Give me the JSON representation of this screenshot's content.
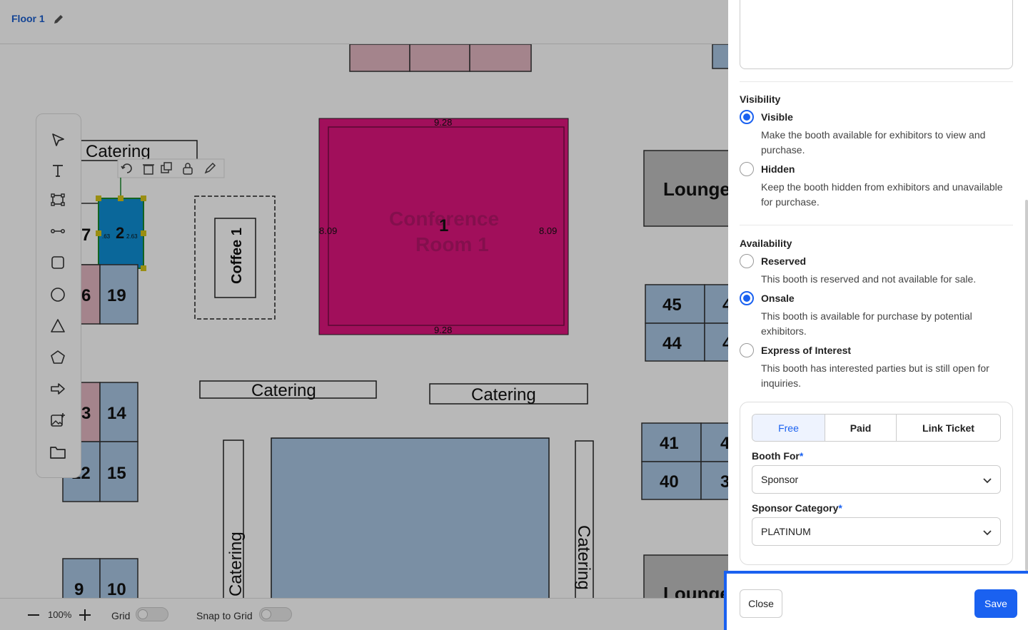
{
  "header": {
    "floor_name": "Floor 1"
  },
  "floor_plan": {
    "catering_labels": [
      "Catering",
      "Catering",
      "Catering",
      "Catering",
      "Catering"
    ],
    "lounge_labels": [
      "Lounge",
      "Lounge"
    ],
    "coffee_label": "Coffee 1",
    "conference": {
      "title_line1": "Conference",
      "title_line2": "Room 1",
      "number": "1",
      "width_top": "9.28",
      "width_bottom": "9.28",
      "height_left": "8.09",
      "height_right": "8.09"
    },
    "selected_booth": {
      "number": "2",
      "dim_left": ".63",
      "dim_right": "2.63"
    },
    "booths": {
      "b7": "7",
      "b6": "6",
      "b19": "19",
      "b3": "3",
      "b14": "14",
      "b12": "12",
      "b15": "15",
      "b9": "9",
      "b10": "10",
      "b45": "45",
      "b44": "44",
      "b41": "41",
      "b40": "40",
      "b45b": "4",
      "b44b": "4",
      "b41b": "4",
      "b40b": "3"
    }
  },
  "bottom_bar": {
    "zoom_level": "100%",
    "grid_label": "Grid",
    "snap_label": "Snap to Grid"
  },
  "panel": {
    "visibility": {
      "title": "Visibility",
      "visible_label": "Visible",
      "visible_desc": "Make the booth available for exhibitors to view and purchase.",
      "hidden_label": "Hidden",
      "hidden_desc": "Keep the booth hidden from exhibitors and unavailable for purchase."
    },
    "availability": {
      "title": "Availability",
      "reserved_label": "Reserved",
      "reserved_desc": "This booth is reserved and not available for sale.",
      "onsale_label": "Onsale",
      "onsale_desc": "This booth is available for purchase by potential exhibitors.",
      "eoi_label": "Express of Interest",
      "eoi_desc": "This booth has interested parties but is still open for inquiries."
    },
    "ticket_tabs": [
      "Free",
      "Paid",
      "Link Ticket"
    ],
    "booth_for_label": "Booth For",
    "booth_for_value": "Sponsor",
    "sponsor_category_label": "Sponsor Category",
    "sponsor_category_value": "PLATINUM",
    "required_mark": "*",
    "close_label": "Close",
    "save_label": "Save"
  },
  "colors": {
    "accent": "#1a61f0",
    "booth_blue": "#a9c7e4",
    "booth_pink": "#e3b7c3",
    "conference": "#e0157f",
    "lounge": "#c0c0c0"
  }
}
